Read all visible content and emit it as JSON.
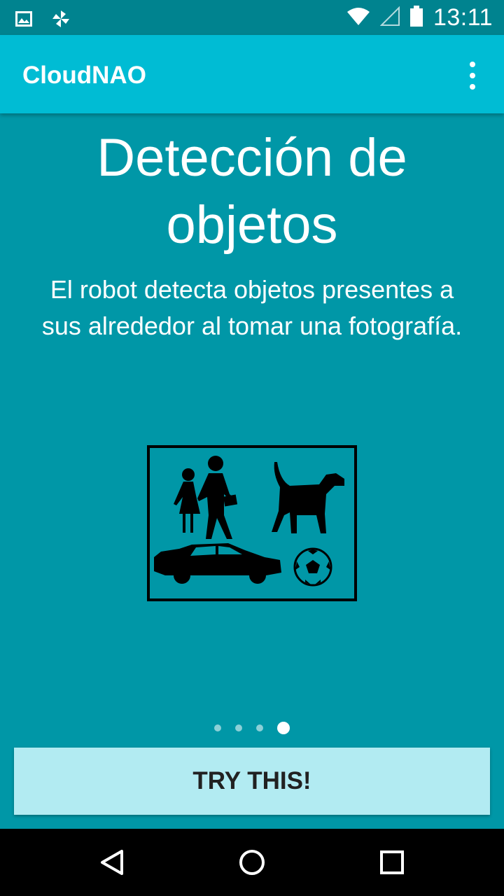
{
  "status_bar": {
    "time": "13:11",
    "icons": [
      "image-notification-icon",
      "pinwheel-notification-icon",
      "wifi-icon",
      "cell-signal-icon",
      "battery-icon"
    ]
  },
  "app_bar": {
    "title": "CloudNAO",
    "menu_icon": "more-vert-icon"
  },
  "content": {
    "headline_line1": "Detección de",
    "headline_line2": "objetos",
    "description_line1": "El robot detecta objetos presentes a",
    "description_line2": "sus alrededor al tomar una fotografía.",
    "illustration_icon": "object-detection-illustration"
  },
  "pager": {
    "total_pages": 4,
    "current_page": 4
  },
  "action": {
    "try_label": "TRY THIS!"
  },
  "nav_bar": {
    "buttons": [
      "back-icon",
      "home-icon",
      "recents-icon"
    ]
  },
  "colors": {
    "status_bar": "#00838f",
    "app_bar": "#00bcd4",
    "background": "#0097a7",
    "button": "#b2ebf2"
  }
}
